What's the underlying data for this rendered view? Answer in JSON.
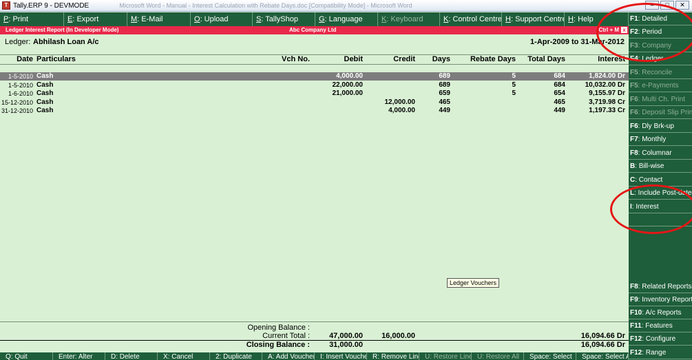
{
  "window": {
    "title": "Tally.ERP 9 - DEVMODE",
    "ghost_title": "Microsoft Word - Manual - Interest Calculation with Rebate Days.doc [Compatibility Mode] - Microsoft Word",
    "min": "–",
    "max": "□",
    "close": "✕"
  },
  "toolbar": [
    {
      "key": "P",
      "label": ": Print",
      "disabled": false
    },
    {
      "key": "E",
      "label": ": Export",
      "disabled": false
    },
    {
      "key": "M",
      "label": ": E-Mail",
      "disabled": false
    },
    {
      "key": "O",
      "label": ": Upload",
      "disabled": false
    },
    {
      "key": "S",
      "label": ": TallyShop",
      "disabled": false
    },
    {
      "key": "G",
      "label": ": Language",
      "disabled": false
    },
    {
      "key": "K",
      "label": ": Keyboard",
      "disabled": true
    },
    {
      "key": "K",
      "label": ": Control Centre",
      "disabled": false
    },
    {
      "key": "H",
      "label": ": Support Centre",
      "disabled": false
    },
    {
      "key": "H",
      "label": ": Help",
      "disabled": false
    }
  ],
  "report": {
    "title": "Ledger Interest Report (In Developer Mode)",
    "company": "Abc Company Ltd",
    "shortcut": "Ctrl + M",
    "close": "x",
    "ledger_label": "Ledger:",
    "ledger_name": "Abhilash Loan A/c",
    "period": "1-Apr-2009 to 31-Mar-2012"
  },
  "columns": {
    "date": "Date",
    "particulars": "Particulars",
    "vch_no": "Vch No.",
    "debit": "Debit",
    "credit": "Credit",
    "days": "Days",
    "rebate_days": "Rebate Days",
    "total_days": "Total Days",
    "interest": "Interest"
  },
  "rows": [
    {
      "date": "1-5-2010",
      "particulars": "Cash",
      "vch_no": "",
      "debit": "4,000.00",
      "credit": "",
      "days": "689",
      "rebate_days": "5",
      "total_days": "684",
      "interest": "1,824.00 Dr",
      "selected": true
    },
    {
      "date": "1-5-2010",
      "particulars": "Cash",
      "vch_no": "",
      "debit": "22,000.00",
      "credit": "",
      "days": "689",
      "rebate_days": "5",
      "total_days": "684",
      "interest": "10,032.00 Dr",
      "selected": false
    },
    {
      "date": "1-6-2010",
      "particulars": "Cash",
      "vch_no": "",
      "debit": "21,000.00",
      "credit": "",
      "days": "659",
      "rebate_days": "5",
      "total_days": "654",
      "interest": "9,155.97 Dr",
      "selected": false
    },
    {
      "date": "15-12-2010",
      "particulars": "Cash",
      "vch_no": "",
      "debit": "",
      "credit": "12,000.00",
      "days": "465",
      "rebate_days": "",
      "total_days": "465",
      "interest": "3,719.98 Cr",
      "selected": false
    },
    {
      "date": "31-12-2010",
      "particulars": "Cash",
      "vch_no": "",
      "debit": "",
      "credit": "4,000.00",
      "days": "449",
      "rebate_days": "",
      "total_days": "449",
      "interest": "1,197.33 Cr",
      "selected": false
    }
  ],
  "tooltip": "Ledger Vouchers",
  "totals": {
    "opening_label": "Opening Balance :",
    "current_label": "Current Total :",
    "current_debit": "47,000.00",
    "current_credit": "16,000.00",
    "current_interest": "16,094.66 Dr",
    "closing_label": "Closing Balance :",
    "closing_debit": "31,000.00",
    "closing_interest": "16,094.66 Dr"
  },
  "bottombar": [
    {
      "label": "Q: Quit",
      "disabled": false
    },
    {
      "label": "Enter: Alter",
      "disabled": false
    },
    {
      "label": "D: Delete",
      "disabled": false
    },
    {
      "label": "X: Cancel",
      "disabled": false
    },
    {
      "label": "2: Duplicate",
      "disabled": false
    },
    {
      "label": "A: Add Voucher",
      "disabled": false
    },
    {
      "label": "I: Insert Voucher",
      "disabled": false
    },
    {
      "label": "R: Remove Line",
      "disabled": false
    },
    {
      "label": "U: Restore Line",
      "disabled": true
    },
    {
      "label": "U: Restore All",
      "disabled": true
    },
    {
      "label": "Space: Select",
      "disabled": false
    },
    {
      "label": "Space: Select All",
      "disabled": false
    }
  ],
  "sidebar": [
    {
      "key": "F1",
      "label": ": Detailed",
      "disabled": false
    },
    {
      "key": "F2",
      "label": ": Period",
      "disabled": false
    },
    {
      "key": "F3",
      "label": ": Company",
      "disabled": true
    },
    {
      "key": "F4",
      "label": ": Ledger",
      "disabled": false
    },
    {
      "key": "F5",
      "label": ": Reconcile",
      "disabled": true
    },
    {
      "key": "F5",
      "label": ": e-Payments",
      "disabled": true
    },
    {
      "key": "F6",
      "label": ": Multi Ch. Print",
      "disabled": true
    },
    {
      "key": "F6",
      "label": ": Deposit Slip Print",
      "disabled": true
    },
    {
      "key": "F6",
      "label": ": Dly Brk-up",
      "disabled": false
    },
    {
      "key": "F7",
      "label": ": Monthly",
      "disabled": false
    },
    {
      "key": "F8",
      "label": ": Columnar",
      "disabled": false
    },
    {
      "key": "B",
      "label": ": Bill-wise",
      "disabled": false
    },
    {
      "key": "C",
      "label": ": Contact",
      "disabled": false
    },
    {
      "key": "L",
      "label": ": Include Post-dated",
      "disabled": false
    },
    {
      "key": "I",
      "label": ": Interest",
      "disabled": false
    },
    {
      "key": "",
      "label": "",
      "disabled": false
    },
    {
      "key": "F8",
      "label": ": Related Reports",
      "disabled": false
    },
    {
      "key": "F9",
      "label": ": Inventory Reports",
      "disabled": false
    },
    {
      "key": "F10",
      "label": ": A/c Reports",
      "disabled": false
    },
    {
      "key": "F11",
      "label": ": Features",
      "disabled": false
    },
    {
      "key": "F12",
      "label": ": Configure",
      "disabled": false
    },
    {
      "key": "F12",
      "label": ": Range",
      "disabled": false
    }
  ],
  "colors": {
    "bar": "#1f5e3b",
    "report_bg": "#d9f0d4",
    "title_red": "#e8294a",
    "annotation": "#e51616"
  }
}
